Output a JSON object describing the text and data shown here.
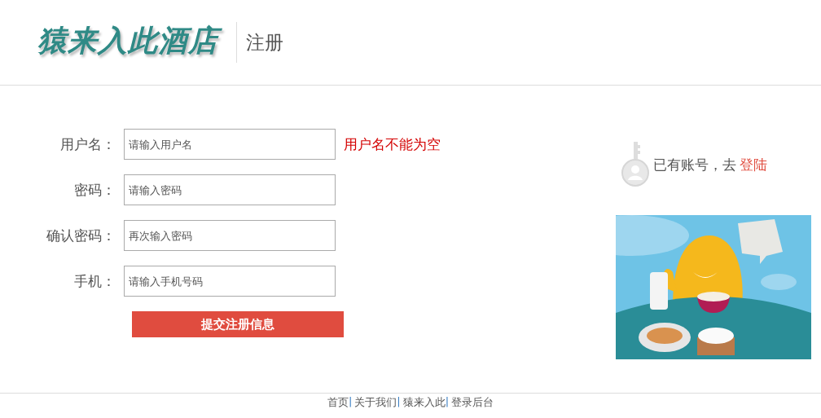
{
  "header": {
    "logo": "猿来入此酒店",
    "title": "注册"
  },
  "form": {
    "fields": [
      {
        "label": "用户名：",
        "placeholder": "请输入用户名",
        "error": "用户名不能为空"
      },
      {
        "label": "密码：",
        "placeholder": "请输入密码"
      },
      {
        "label": "确认密码：",
        "placeholder": "再次输入密码"
      },
      {
        "label": "手机：",
        "placeholder": "请输入手机号码"
      }
    ],
    "submit": "提交注册信息"
  },
  "aside": {
    "prompt": "已有账号，去",
    "login_link": "登陆"
  },
  "footer": {
    "links": [
      {
        "label": "首页",
        "separator": "|"
      },
      {
        "label": "关于我们",
        "separator": "|"
      },
      {
        "label": "猿来入此",
        "separator": "|"
      },
      {
        "label": "登录后台"
      }
    ]
  }
}
